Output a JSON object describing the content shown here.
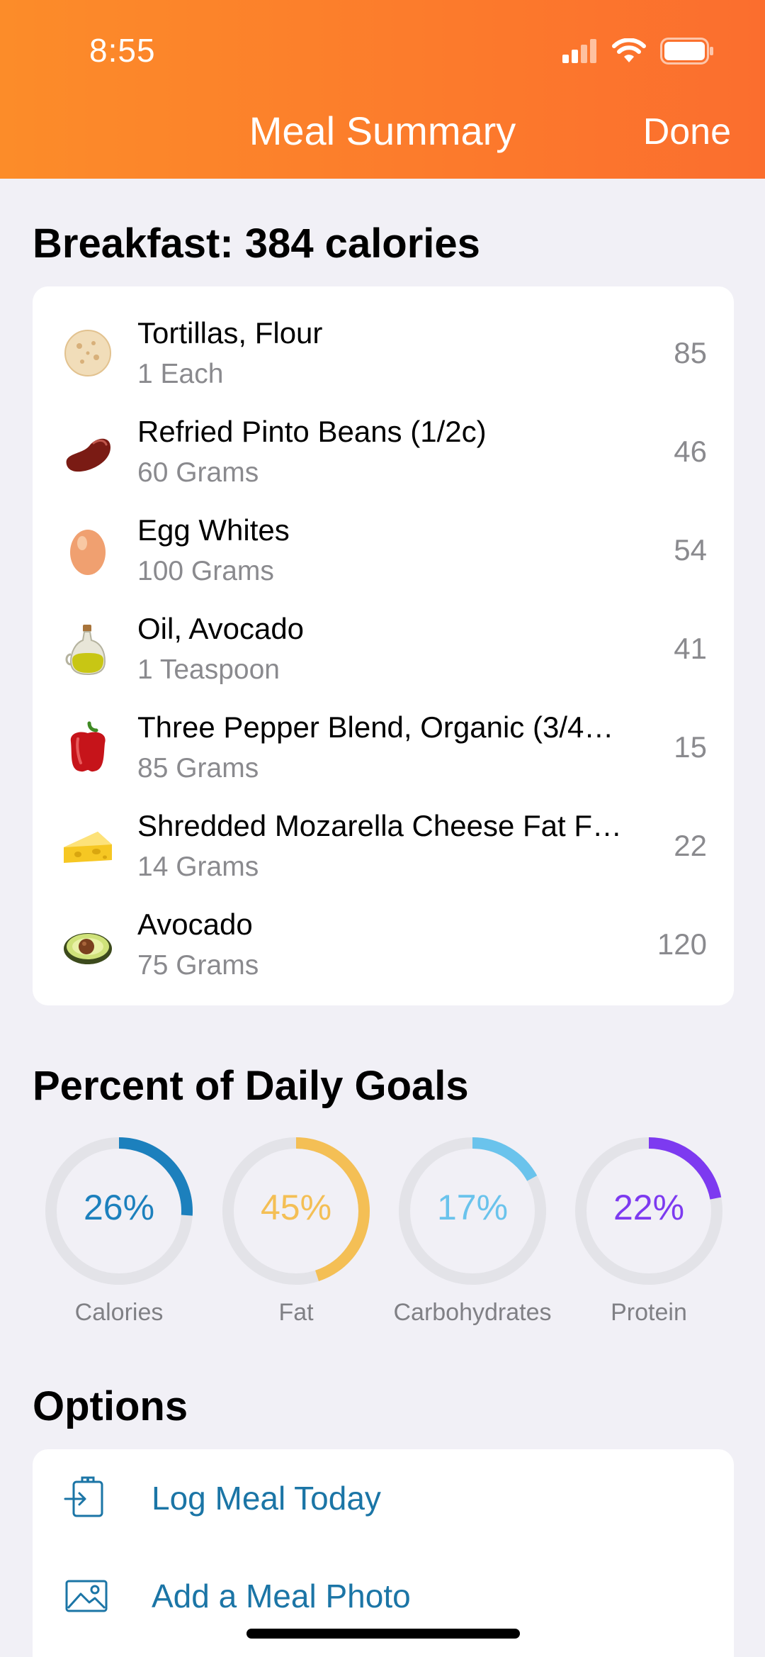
{
  "status_bar": {
    "time": "8:55",
    "icons": [
      "cellular-signal-icon",
      "wifi-icon",
      "battery-icon"
    ]
  },
  "nav": {
    "title": "Meal Summary",
    "done_label": "Done"
  },
  "meal": {
    "title": "Breakfast: 384 calories",
    "items": [
      {
        "name": "Tortillas, Flour",
        "amount": "1 Each",
        "calories": "85",
        "icon": "tortilla-icon"
      },
      {
        "name": "Refried Pinto Beans (1/2c)",
        "amount": "60 Grams",
        "calories": "46",
        "icon": "bean-icon"
      },
      {
        "name": "Egg Whites",
        "amount": "100 Grams",
        "calories": "54",
        "icon": "egg-icon"
      },
      {
        "name": "Oil, Avocado",
        "amount": "1 Teaspoon",
        "calories": "41",
        "icon": "oil-bottle-icon"
      },
      {
        "name": "Three Pepper Blend, Organic (3/4…",
        "amount": "85 Grams",
        "calories": "15",
        "icon": "bell-pepper-icon"
      },
      {
        "name": "Shredded Mozarella Cheese Fat F…",
        "amount": "14 Grams",
        "calories": "22",
        "icon": "cheese-icon"
      },
      {
        "name": "Avocado",
        "amount": "75 Grams",
        "calories": "120",
        "icon": "avocado-icon"
      }
    ]
  },
  "goals": {
    "title": "Percent of Daily Goals",
    "rings": [
      {
        "label": "Calories",
        "value": "26%",
        "fraction": 0.26,
        "color": "#1c80bd"
      },
      {
        "label": "Fat",
        "value": "45%",
        "fraction": 0.45,
        "color": "#f4bf55"
      },
      {
        "label": "Carbohydrates",
        "value": "17%",
        "fraction": 0.17,
        "color": "#6ac3ec"
      },
      {
        "label": "Protein",
        "value": "22%",
        "fraction": 0.22,
        "color": "#7d3af0"
      }
    ]
  },
  "options": {
    "title": "Options",
    "items": [
      {
        "label": "Log Meal Today",
        "icon": "log-meal-icon"
      },
      {
        "label": "Add a Meal Photo",
        "icon": "photo-icon"
      }
    ]
  },
  "colors": {
    "header_orange": "#fc7f2c",
    "link_blue": "#1b75a6",
    "background": "#f1f0f6"
  }
}
